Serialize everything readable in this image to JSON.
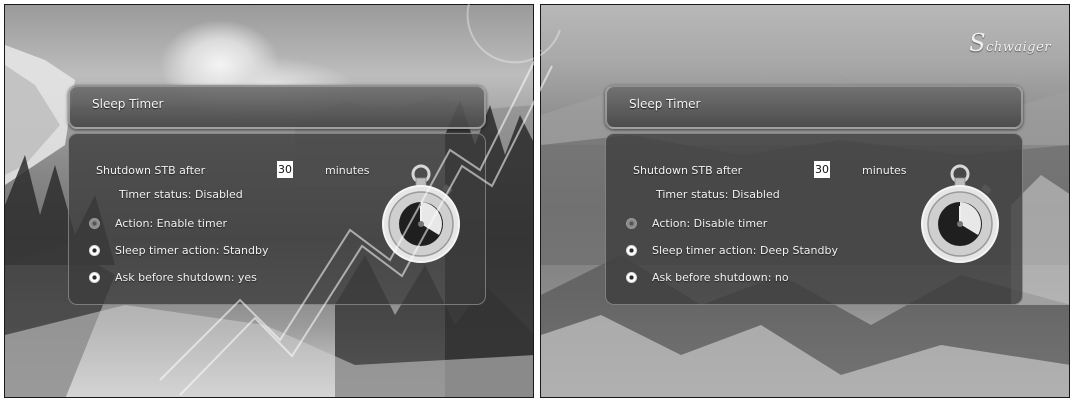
{
  "screens": [
    {
      "title": "Sleep Timer",
      "shutdown_label": "Shutdown STB after",
      "minutes_value": "30",
      "minutes_label": "minutes",
      "timer_status": "Timer status: Disabled",
      "options": [
        {
          "label": "Action: Enable timer",
          "state": "inactive"
        },
        {
          "label": "Sleep timer action: Standby",
          "state": "active"
        },
        {
          "label": "Ask before shutdown: yes",
          "state": "active"
        }
      ],
      "background": "winter-forest"
    },
    {
      "title": "Sleep Timer",
      "shutdown_label": "Shutdown STB after",
      "minutes_value": "30",
      "minutes_label": "minutes",
      "timer_status": "Timer status: Disabled",
      "options": [
        {
          "label": "Action: Disable timer",
          "state": "inactive"
        },
        {
          "label": "Sleep timer action: Deep Standby",
          "state": "active"
        },
        {
          "label": "Ask before shutdown: no",
          "state": "active"
        }
      ],
      "background": "alpine-mountains",
      "logo": {
        "initial": "S",
        "rest": "chwaiger"
      }
    }
  ],
  "icons": {
    "timer": "stopwatch-icon",
    "radio": "radio-button-icon"
  },
  "colors": {
    "panel": "#3c3c3c",
    "text": "#f2f2f2",
    "input_bg": "#ffffff"
  }
}
